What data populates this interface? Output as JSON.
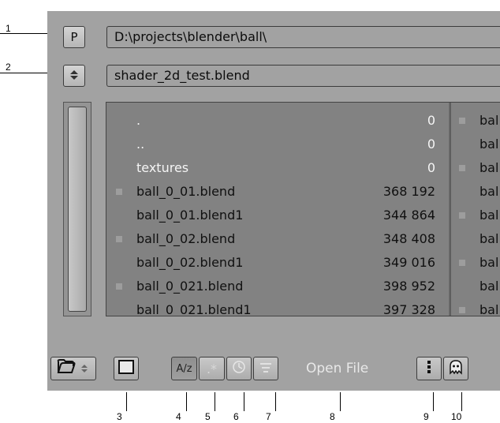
{
  "callouts": [
    "1",
    "2",
    "3",
    "4",
    "5",
    "6",
    "7",
    "8",
    "9",
    "10"
  ],
  "header": {
    "parent_button_label": "P",
    "directory_path": "D:\\projects\\blender\\ball\\",
    "file_name": "shader_2d_test.blend"
  },
  "files": [
    {
      "name": ".",
      "size": "0",
      "type": "dir"
    },
    {
      "name": "..",
      "size": "0",
      "type": "dir"
    },
    {
      "name": "textures",
      "size": "0",
      "type": "dir"
    },
    {
      "name": "ball_0_01.blend",
      "size": "368 192",
      "type": "blend"
    },
    {
      "name": "ball_0_01.blend1",
      "size": "344 864",
      "type": "backup"
    },
    {
      "name": "ball_0_02.blend",
      "size": "348 408",
      "type": "blend"
    },
    {
      "name": "ball_0_02.blend1",
      "size": "349 016",
      "type": "backup"
    },
    {
      "name": "ball_0_021.blend",
      "size": "398 952",
      "type": "blend"
    },
    {
      "name": "ball_0_021.blend1",
      "size": "397 328",
      "type": "backup"
    }
  ],
  "second_column": [
    "bal",
    "bal",
    "bal",
    "bal",
    "bal",
    "bal",
    "bal",
    "bal",
    "bal"
  ],
  "toolbar": {
    "sort_alpha_label": "A/z",
    "sort_ext_label": ".*",
    "open_file_label": "Open File"
  },
  "colors": {
    "panel_bg": "#a2a2a2",
    "list_bg": "#828282",
    "dir_text": "#f5f5f5",
    "file_text": "#101010"
  }
}
